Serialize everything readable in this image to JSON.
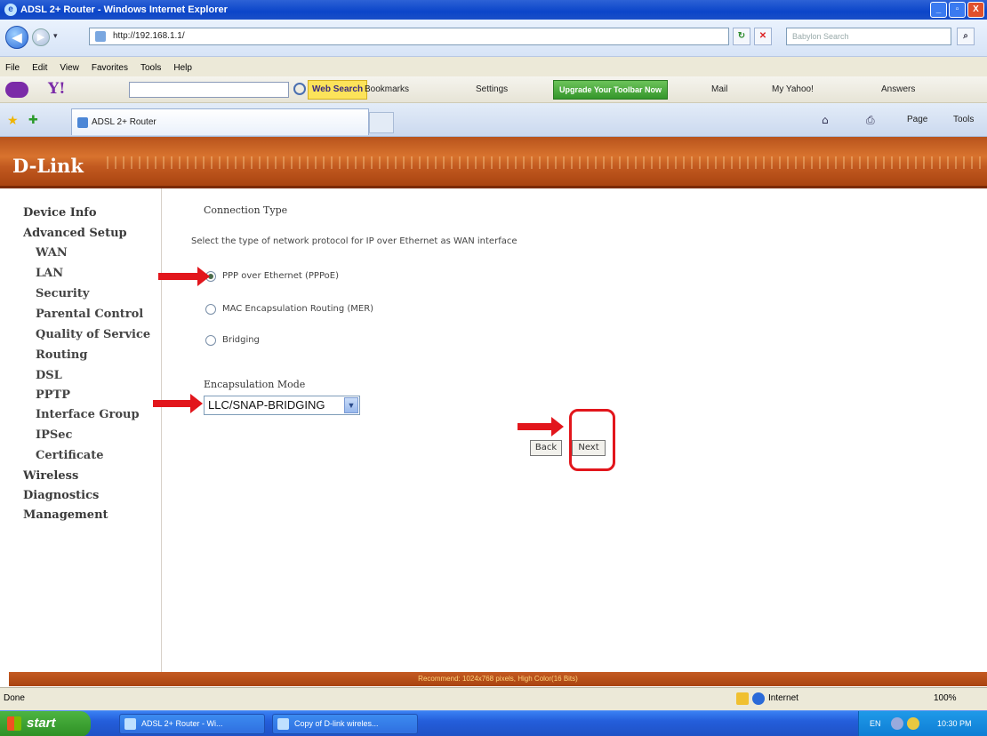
{
  "window": {
    "title": "ADSL 2+ Router - Windows Internet Explorer",
    "min": "_",
    "max": "▫",
    "close": "X"
  },
  "address": {
    "url": "http://192.168.1.1/",
    "search_placeholder": "Babylon Search"
  },
  "menu": [
    "File",
    "Edit",
    "View",
    "Favorites",
    "Tools",
    "Help"
  ],
  "yahoo_toolbar": {
    "web_search": "Web Search",
    "bookmarks": "Bookmarks",
    "settings": "Settings",
    "upgrade": "Upgrade Your Toolbar Now",
    "mail": "Mail",
    "my_yahoo": "My Yahoo!",
    "answers": "Answers"
  },
  "tab": {
    "title": "ADSL 2+ Router",
    "page_menu": "Page",
    "tools_menu": "Tools"
  },
  "brand": {
    "logo": "D-Link"
  },
  "sidebar": [
    {
      "label": "Device Info",
      "sub": false
    },
    {
      "label": "Advanced Setup",
      "sub": false
    },
    {
      "label": "WAN",
      "sub": true
    },
    {
      "label": "LAN",
      "sub": true
    },
    {
      "label": "Security",
      "sub": true
    },
    {
      "label": "Parental Control",
      "sub": true
    },
    {
      "label": "Quality of Service",
      "sub": true
    },
    {
      "label": "Routing",
      "sub": true
    },
    {
      "label": "DSL",
      "sub": true
    },
    {
      "label": "PPTP",
      "sub": true
    },
    {
      "label": "Interface Group",
      "sub": true
    },
    {
      "label": "IPSec",
      "sub": true
    },
    {
      "label": "Certificate",
      "sub": true
    },
    {
      "label": "Wireless",
      "sub": false
    },
    {
      "label": "Diagnostics",
      "sub": false
    },
    {
      "label": "Management",
      "sub": false
    }
  ],
  "main": {
    "heading": "Connection Type",
    "description": "Select the type of network protocol for IP over Ethernet as WAN interface",
    "options": [
      {
        "label": "PPP over Ethernet (PPPoE)",
        "selected": true
      },
      {
        "label": "MAC Encapsulation Routing (MER)",
        "selected": false
      },
      {
        "label": "Bridging",
        "selected": false
      }
    ],
    "encap_label": "Encapsulation Mode",
    "encap_value": "LLC/SNAP-BRIDGING",
    "back": "Back",
    "next": "Next"
  },
  "footer_note": "Recommend: 1024x768 pixels, High Color(16 Bits)",
  "status": {
    "left": "Done",
    "zone": "Internet",
    "zoom": "100%"
  },
  "taskbar": {
    "start": "start",
    "tasks": [
      "ADSL 2+ Router - Wi...",
      "Copy of D-link wireles..."
    ],
    "lang": "EN",
    "time": "10:30 PM"
  },
  "colors": {
    "accent": "#c25a20",
    "annotation": "#e2161c"
  }
}
